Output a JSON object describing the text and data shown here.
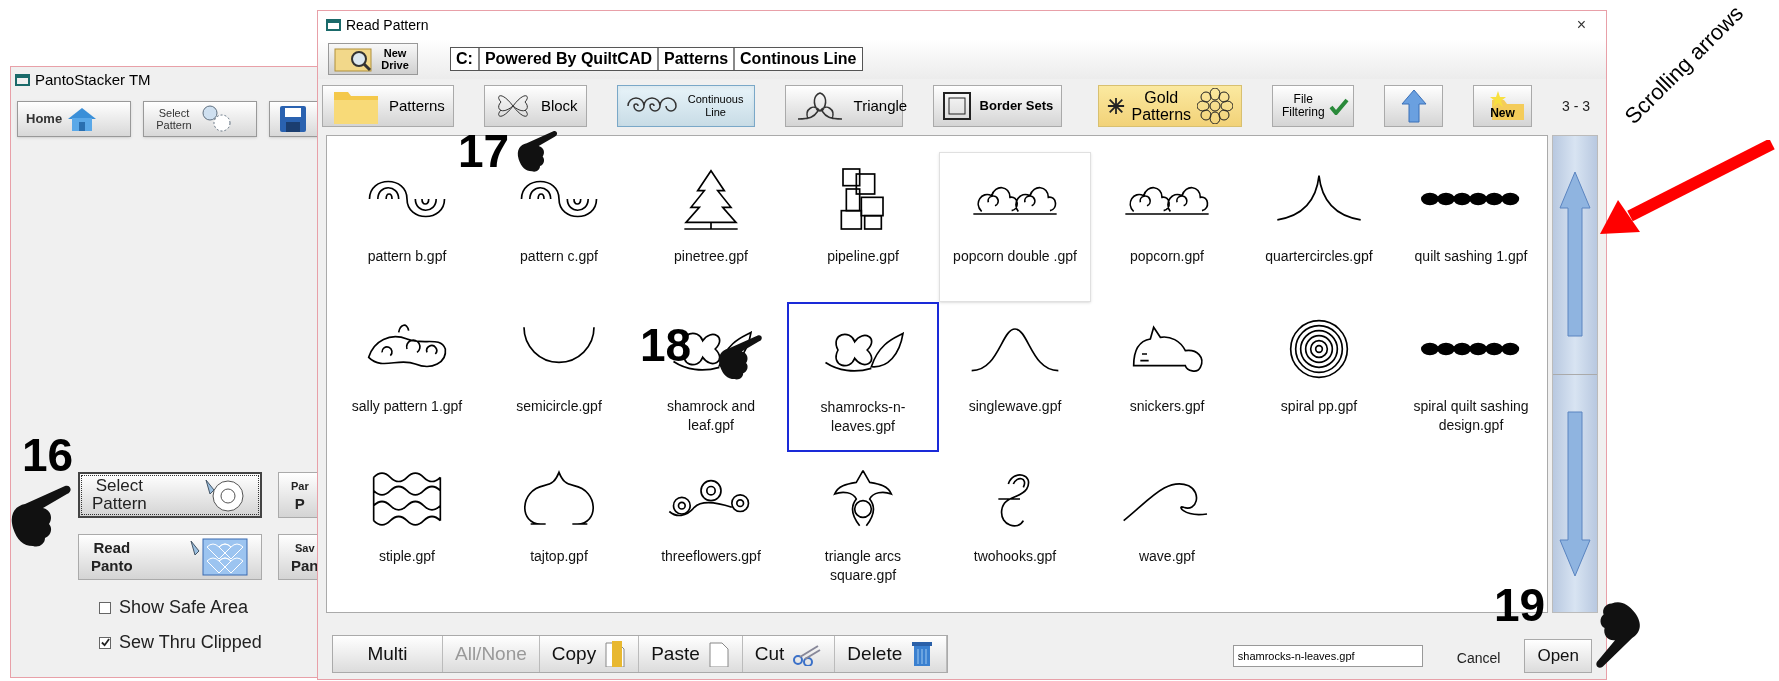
{
  "main_window": {
    "title": "PantoStacker TM",
    "toolbar": [
      {
        "kind": "home",
        "label": "Home"
      },
      {
        "kind": "select",
        "label": "Select Pattern"
      },
      {
        "kind": "save"
      }
    ],
    "panel_buttons": [
      {
        "kind": "select",
        "lines": [
          "Select",
          "Pattern"
        ],
        "focused": true
      },
      {
        "kind": "partial",
        "lines": [
          "Par",
          "P"
        ],
        "focused": false
      },
      {
        "kind": "read",
        "lines": [
          "Read",
          "Panto"
        ],
        "focused": false
      },
      {
        "kind": "partial",
        "lines": [
          "Sav",
          "Pan"
        ],
        "focused": false
      }
    ],
    "checkboxes": [
      {
        "label": "Show Safe Area",
        "checked": false
      },
      {
        "label": "Sew Thru Clipped",
        "checked": true
      }
    ]
  },
  "dialog": {
    "title": "Read Pattern",
    "close": "×",
    "new_drive": "New Drive",
    "path": [
      "C:",
      "Powered By QuiltCAD",
      "Patterns",
      "Continous Line"
    ],
    "categories": [
      {
        "kind": "folder",
        "label": "Patterns",
        "selected": false
      },
      {
        "kind": "block",
        "label": "Block",
        "selected": false
      },
      {
        "kind": "continuous",
        "label": "Continuous Line",
        "selected": true
      },
      {
        "kind": "triangle",
        "label": "Triangle",
        "selected": false
      },
      {
        "kind": "border",
        "label": "Border Sets",
        "selected": false
      }
    ],
    "tools": [
      {
        "kind": "gold",
        "label": "Gold Patterns"
      },
      {
        "kind": "filter",
        "label": "File Filtering"
      },
      {
        "kind": "up"
      },
      {
        "kind": "new",
        "label": "New"
      }
    ],
    "page": "3 - 3",
    "files": [
      {
        "name": "pattern b.gpf",
        "selected": false,
        "hovered": false
      },
      {
        "name": "pattern c.gpf",
        "selected": false,
        "hovered": false
      },
      {
        "name": "pinetree.gpf",
        "selected": false,
        "hovered": false
      },
      {
        "name": "pipeline.gpf",
        "selected": false,
        "hovered": false
      },
      {
        "name": "popcorn double .gpf",
        "selected": false,
        "hovered": true
      },
      {
        "name": "popcorn.gpf",
        "selected": false,
        "hovered": false
      },
      {
        "name": "quartercircles.gpf",
        "selected": false,
        "hovered": false
      },
      {
        "name": "quilt sashing 1.gpf",
        "selected": false,
        "hovered": false
      },
      {
        "name": "sally pattern 1.gpf",
        "selected": false,
        "hovered": false
      },
      {
        "name": "semicircle.gpf",
        "selected": false,
        "hovered": false
      },
      {
        "name": "shamrock and leaf.gpf",
        "selected": false,
        "hovered": false
      },
      {
        "name": "shamrocks-n-leaves.gpf",
        "selected": true,
        "hovered": false
      },
      {
        "name": "singlewave.gpf",
        "selected": false,
        "hovered": false
      },
      {
        "name": "snickers.gpf",
        "selected": false,
        "hovered": false
      },
      {
        "name": "spiral pp.gpf",
        "selected": false,
        "hovered": false
      },
      {
        "name": "spiral quilt sashing design.gpf",
        "selected": false,
        "hovered": false
      },
      {
        "name": "stiple.gpf",
        "selected": false,
        "hovered": false
      },
      {
        "name": "tajtop.gpf",
        "selected": false,
        "hovered": false
      },
      {
        "name": "threeflowers.gpf",
        "selected": false,
        "hovered": false
      },
      {
        "name": "triangle arcs square.gpf",
        "selected": false,
        "hovered": false
      },
      {
        "name": "twohooks.gpf",
        "selected": false,
        "hovered": false
      },
      {
        "name": "wave.gpf",
        "selected": false,
        "hovered": false
      }
    ],
    "actions": [
      {
        "kind": "plain",
        "label": "Multi",
        "disabled": false
      },
      {
        "kind": "plain",
        "label": "All/None",
        "disabled": true
      },
      {
        "kind": "copy",
        "label": "Copy",
        "disabled": false
      },
      {
        "kind": "paste",
        "label": "Paste",
        "disabled": false
      },
      {
        "kind": "cut",
        "label": "Cut",
        "disabled": false
      },
      {
        "kind": "delete",
        "label": "Delete",
        "disabled": false
      }
    ],
    "filename": "shamrocks-n-leaves.gpf",
    "cancel": "Cancel",
    "open": "Open"
  },
  "annotations": [
    {
      "label": "16"
    },
    {
      "label": "17"
    },
    {
      "label": "18"
    },
    {
      "label": "19"
    }
  ],
  "callout": {
    "label": "Scrolling arrows"
  }
}
